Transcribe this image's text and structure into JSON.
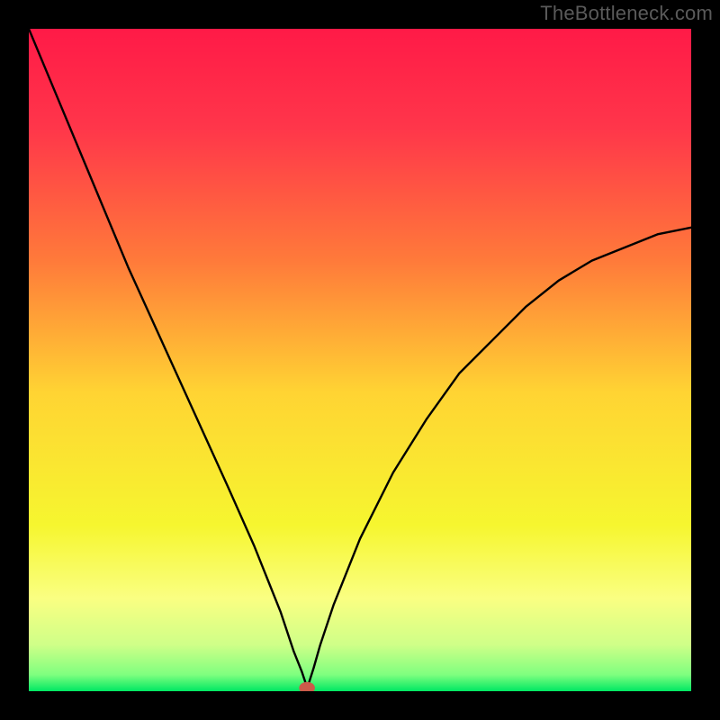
{
  "watermark": "TheBottleneck.com",
  "chart_data": {
    "type": "line",
    "title": "",
    "xlabel": "",
    "ylabel": "",
    "xlim": [
      0,
      100
    ],
    "ylim": [
      0,
      100
    ],
    "grid": false,
    "background_gradient": {
      "stops": [
        {
          "offset": 0.0,
          "color": "#ff1a47"
        },
        {
          "offset": 0.15,
          "color": "#ff364a"
        },
        {
          "offset": 0.35,
          "color": "#ff7a3a"
        },
        {
          "offset": 0.55,
          "color": "#ffd433"
        },
        {
          "offset": 0.75,
          "color": "#f6f62f"
        },
        {
          "offset": 0.86,
          "color": "#faff82"
        },
        {
          "offset": 0.93,
          "color": "#cfff88"
        },
        {
          "offset": 0.975,
          "color": "#7fff7f"
        },
        {
          "offset": 1.0,
          "color": "#00e863"
        }
      ]
    },
    "series": [
      {
        "name": "bottleneck-curve",
        "x": [
          0,
          5,
          10,
          15,
          20,
          25,
          30,
          34,
          36,
          38,
          39,
          40,
          41.2,
          41.8,
          42,
          42.3,
          43,
          44,
          46,
          50,
          55,
          60,
          65,
          70,
          75,
          80,
          85,
          90,
          95,
          100
        ],
        "y": [
          100,
          88,
          76,
          64,
          53,
          42,
          31,
          22,
          17,
          12,
          9,
          6,
          3,
          1.2,
          0.5,
          1.3,
          3.5,
          7,
          13,
          23,
          33,
          41,
          48,
          53,
          58,
          62,
          65,
          67,
          69,
          70
        ]
      }
    ],
    "marker": {
      "name": "optimal-point",
      "x": 42,
      "y": 0.5,
      "rx": 1.2,
      "ry": 0.9,
      "color": "#cc5a4a"
    }
  }
}
